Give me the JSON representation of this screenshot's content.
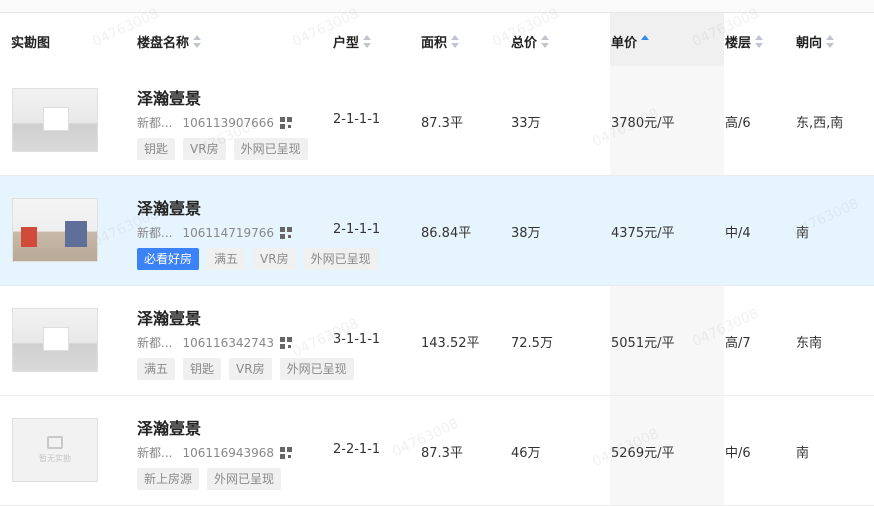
{
  "table": {
    "headers": [
      {
        "label": "实勘图",
        "sortable": false
      },
      {
        "label": "楼盘名称",
        "sortable": true
      },
      {
        "label": "户型",
        "sortable": true
      },
      {
        "label": "面积",
        "sortable": true
      },
      {
        "label": "总价",
        "sortable": true
      },
      {
        "label": "单价",
        "sortable": true,
        "sort": "asc"
      },
      {
        "label": "楼层",
        "sortable": true
      },
      {
        "label": "朝向",
        "sortable": true
      }
    ],
    "rows": [
      {
        "thumb": "room-photo",
        "name": "泽瀚壹景",
        "district": "新都...",
        "code": "106113907666",
        "tags": [
          "钥匙",
          "VR房",
          "外网已呈现"
        ],
        "layout": "2-1-1-1",
        "area": "87.3平",
        "total": "33万",
        "unit_price": "3780元/平",
        "floor": "高/6",
        "orientation": "东,西,南"
      },
      {
        "thumb": "room-photo",
        "name": "泽瀚壹景",
        "district": "新都...",
        "code": "106114719766",
        "tags": [
          "必看好房",
          "满五",
          "VR房",
          "外网已呈现"
        ],
        "layout": "2-1-1-1",
        "area": "86.84平",
        "total": "38万",
        "unit_price": "4375元/平",
        "floor": "中/4",
        "orientation": "南",
        "highlighted": true
      },
      {
        "thumb": "room-photo",
        "name": "泽瀚壹景",
        "district": "新都...",
        "code": "106116342743",
        "tags": [
          "满五",
          "钥匙",
          "VR房",
          "外网已呈现"
        ],
        "layout": "3-1-1-1",
        "area": "143.52平",
        "total": "72.5万",
        "unit_price": "5051元/平",
        "floor": "高/7",
        "orientation": "东南"
      },
      {
        "thumb": "no-photo",
        "thumb_text": "暂无实勘",
        "name": "泽瀚壹景",
        "district": "新都...",
        "code": "106116943968",
        "tags": [
          "新上房源",
          "外网已呈现"
        ],
        "layout": "2-2-1-1",
        "area": "87.3平",
        "total": "46万",
        "unit_price": "5269元/平",
        "floor": "中/6",
        "orientation": "南"
      }
    ]
  },
  "watermark": "04763008",
  "colors": {
    "accent": "#2f8bf0",
    "highlight_row": "#e6f5fd",
    "must_see_tag": "#3b82f6"
  }
}
